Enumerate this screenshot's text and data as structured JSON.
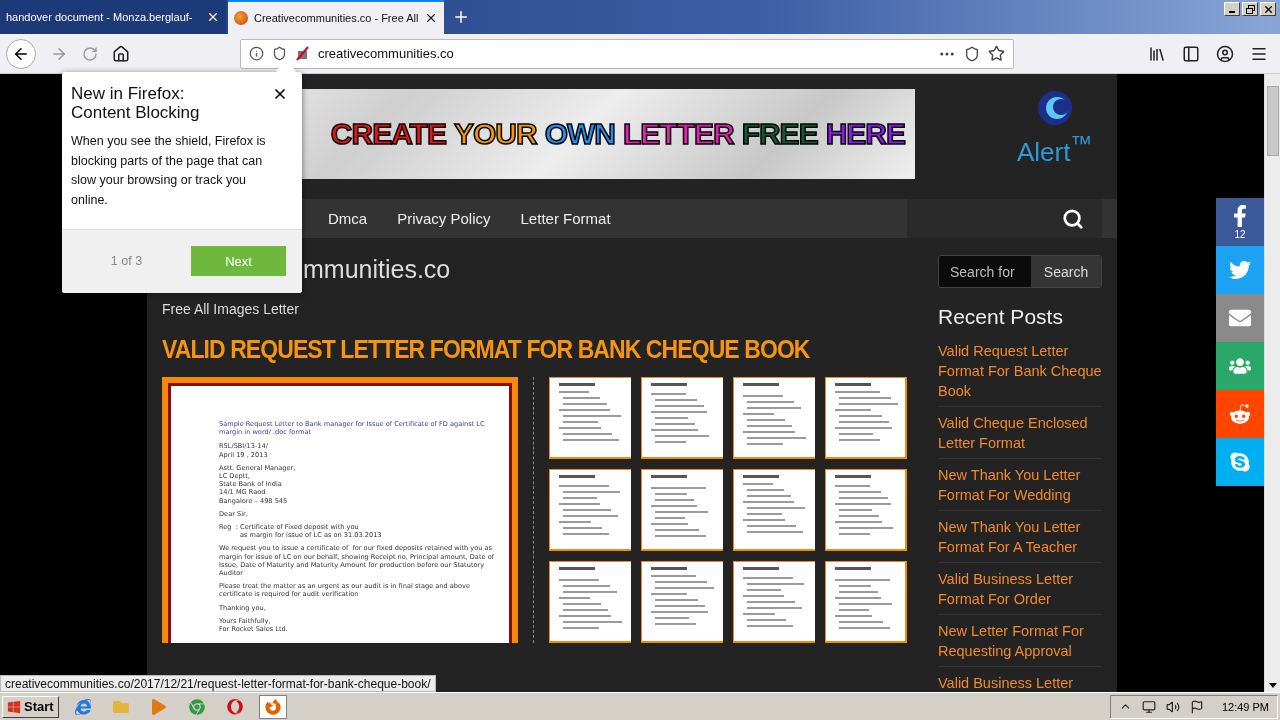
{
  "browser": {
    "tabs": [
      {
        "title": "handover document - Monza.berglauf-",
        "selected": false
      },
      {
        "title": "Creativecommunities.co - Free All",
        "selected": true
      }
    ],
    "url": "creativecommunities.co",
    "popup": {
      "title": "New in Firefox: Content Blocking",
      "body": "When you see the shield, Firefox is blocking parts of the page that can slow your browsing or track you online.",
      "step": "1 of 3",
      "button": "Next"
    },
    "status_url": "creativecommunities.co/2017/12/21/request-letter-format-for-bank-cheque-book/"
  },
  "site": {
    "banner_words": [
      {
        "text": "CREATE",
        "color": "#e3151b"
      },
      {
        "text": "YOUR",
        "color": "#f5950f"
      },
      {
        "text": "OWN",
        "color": "#1e8ff0"
      },
      {
        "text": "LETTER",
        "color": "#e81fb4"
      },
      {
        "text": "FREE",
        "color": "#145a36"
      },
      {
        "text": "HERE",
        "color": "#8a1ee8"
      }
    ],
    "logo": "Alert$^{™}$",
    "nav": [
      "Dmca",
      "Privacy Policy",
      "Letter Format"
    ],
    "site_title": "mmunities.co",
    "tagline": "Free All Images Letter",
    "post_title": "VALID REQUEST LETTER FORMAT FOR BANK CHEQUE BOOK",
    "letter": {
      "heading": "Sample Request Letter to Bank manager for Issue of Certificate of FD against LC margin in word/ .doc format",
      "blocks": [
        {
          "lines": [
            "RSL/SBI/13-14/",
            "April 19 , 2013"
          ]
        },
        {
          "lines": [
            "Astt. General Manager,",
            "LC Deptt,",
            "State Bank of India",
            "14/1 MG Raod",
            "Bangalore – 498 545"
          ]
        },
        {
          "lines": [
            "Dear Sir,"
          ]
        },
        {
          "lines": [
            "Reg  : Certificate of Fixed deposit with you",
            "          as margin for issue of LC as on 31.03.2013"
          ]
        },
        {
          "lines": [
            "We request you to issue a certificate of  for our fixed deposits retained with you as margin for issue of LC on our behalf, showing Receipt no, Principal amount, Date of Issue, Date of Maturity and Maturity Amount for production before our Statutory Auditor"
          ]
        },
        {
          "lines": [
            "Please treat the matter as an urgent as our audit is in final stage and above certificate is required for audit verification"
          ]
        },
        {
          "lines": [
            "Thanking you,"
          ]
        },
        {
          "lines": [
            "Yours Faithfully,",
            "For Rocket Sales Ltd."
          ]
        }
      ]
    },
    "thumbnails": [
      {
        "kind": "document"
      },
      {
        "kind": "document"
      },
      {
        "kind": "document"
      },
      {
        "kind": "document"
      },
      {
        "kind": "document"
      },
      {
        "kind": "document"
      },
      {
        "kind": "document"
      },
      {
        "kind": "document"
      },
      {
        "kind": "document"
      },
      {
        "kind": "document"
      },
      {
        "kind": "document"
      },
      {
        "kind": "document"
      }
    ],
    "search": {
      "placeholder": "Search for",
      "button": "Search"
    },
    "sidebar_title": "Recent Posts",
    "recent_posts": [
      "Valid Request Letter Format For Bank Cheque Book",
      "Valid Cheque Enclosed Letter Format",
      "New Thank You Letter Format For Wedding",
      "New Thank You Letter Format For A Teacher",
      "Valid Business Letter Format For Order",
      "New Letter Format For Requesting Approval",
      "Valid Business Letter"
    ],
    "share": [
      {
        "kind": "facebook",
        "count": "12"
      },
      {
        "kind": "twitter"
      },
      {
        "kind": "email"
      },
      {
        "kind": "group"
      },
      {
        "kind": "reddit"
      },
      {
        "kind": "skype"
      }
    ]
  },
  "taskbar": {
    "start": "Start",
    "apps": [
      {
        "kind": "ie",
        "selected": false
      },
      {
        "kind": "folder",
        "selected": false
      },
      {
        "kind": "media",
        "selected": false
      },
      {
        "kind": "chrome",
        "selected": false
      },
      {
        "kind": "opera",
        "selected": false
      },
      {
        "kind": "firefox",
        "selected": true
      }
    ],
    "clock": "12:49 PM"
  }
}
